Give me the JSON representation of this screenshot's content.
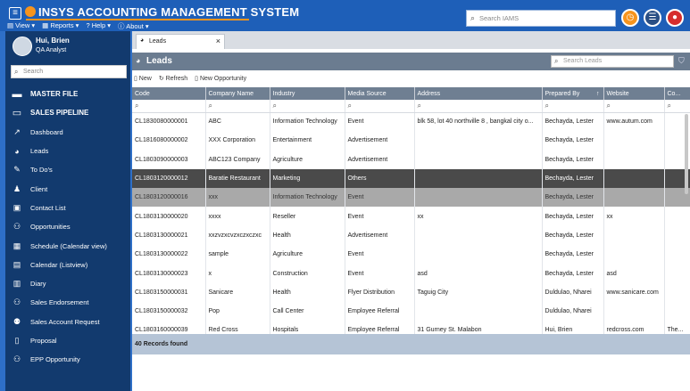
{
  "app": {
    "title": "INSYS ACCOUNTING MANAGEMENT SYSTEM",
    "menu": [
      {
        "label": "View",
        "icon": "list-icon"
      },
      {
        "label": "Reports",
        "icon": "document-icon"
      },
      {
        "label": "Help",
        "icon": "help-icon"
      },
      {
        "label": "About",
        "icon": "info-icon"
      }
    ],
    "search_placeholder": "Search IAMS"
  },
  "user": {
    "name": "Hui, Brien",
    "role": "QA Analyst"
  },
  "sidebar": {
    "search_placeholder": "Search",
    "items": [
      {
        "label": "MASTER FILE",
        "icon": "folder-icon",
        "section": true
      },
      {
        "label": "SALES PIPELINE",
        "icon": "folder-open-icon",
        "section": true
      },
      {
        "label": "Dashboard",
        "icon": "trend-icon"
      },
      {
        "label": "Leads",
        "icon": "leads-icon"
      },
      {
        "label": "To Do's",
        "icon": "pencil-icon"
      },
      {
        "label": "Client",
        "icon": "user-icon"
      },
      {
        "label": "Contact List",
        "icon": "contact-card-icon"
      },
      {
        "label": "Opportunities",
        "icon": "users-icon"
      },
      {
        "label": "Schedule (Calendar view)",
        "icon": "calendar-icon"
      },
      {
        "label": "Calendar (Listview)",
        "icon": "calendar-list-icon"
      },
      {
        "label": "Diary",
        "icon": "book-icon"
      },
      {
        "label": "Sales Endorsement",
        "icon": "users-icon"
      },
      {
        "label": "Sales Account Request",
        "icon": "user-add-icon"
      },
      {
        "label": "Proposal",
        "icon": "document-icon"
      },
      {
        "label": "EPP Opportunity",
        "icon": "users-icon"
      }
    ]
  },
  "tab": {
    "label": "Leads"
  },
  "panel": {
    "title": "Leads",
    "search_placeholder": "Search Leads"
  },
  "toolbar": {
    "new": "New",
    "refresh": "Refresh",
    "new_opportunity": "New Opportunity"
  },
  "columns": [
    "Code",
    "Company Name",
    "Industry",
    "Media Source",
    "Address",
    "Prepared By",
    "Website",
    "Co..."
  ],
  "rows": [
    [
      "CL1830080000001",
      "ABC",
      "Information Technology",
      "Event",
      "blk 58, lot 40 northville 8 , bangkal city o...",
      "Bechayda, Lester",
      "www.autum.com",
      ""
    ],
    [
      "CL1816080000002",
      "XXX Corporation",
      "Entertainment",
      "Advertisement",
      "",
      "Bechayda, Lester",
      "",
      ""
    ],
    [
      "CL1803090000003",
      "ABC123 Company",
      "Agriculture",
      "Advertisement",
      "",
      "Bechayda, Lester",
      "",
      ""
    ],
    [
      "CL1803120000012",
      "Baratie Restaurant",
      "Marketing",
      "Others",
      "",
      "Bechayda, Lester",
      "",
      ""
    ],
    [
      "CL1803120000016",
      "xxx",
      "Information Technology",
      "Event",
      "",
      "Bechayda, Lester",
      "",
      ""
    ],
    [
      "CL1803130000020",
      "xxxx",
      "Reseller",
      "Event",
      "xx",
      "Bechayda, Lester",
      "xx",
      ""
    ],
    [
      "CL1803130000021",
      "xxzvzxcvzxczxczxc",
      "Health",
      "Advertisement",
      "",
      "Bechayda, Lester",
      "",
      ""
    ],
    [
      "CL1803130000022",
      "sample",
      "Agriculture",
      "Event",
      "",
      "Bechayda, Lester",
      "",
      ""
    ],
    [
      "CL1803130000023",
      "x",
      "Construction",
      "Event",
      "asd",
      "Bechayda, Lester",
      "asd",
      ""
    ],
    [
      "CL1803150000031",
      "Sanicare",
      "Health",
      "Flyer Distribution",
      "Taguig City",
      "Duldulao, Nharei",
      "www.sanicare.com",
      ""
    ],
    [
      "CL1803150000032",
      "Pop",
      "Call Center",
      "Employee Referral",
      "",
      "Duldulao, Nharei",
      "",
      ""
    ],
    [
      "CL1803160000039",
      "Red Cross",
      "Hospitals",
      "Employee Referral",
      "31 Gurney St. Malabon",
      "Hui, Brien",
      "redcross.com",
      "The..."
    ]
  ],
  "footer": {
    "records": "40 Records found"
  },
  "colors": {
    "topbar": "#1e5fb8",
    "sidebar": "#123a6e",
    "accent": "#f7941d",
    "header": "#6f7f92",
    "selected": "#4a4a4a"
  }
}
